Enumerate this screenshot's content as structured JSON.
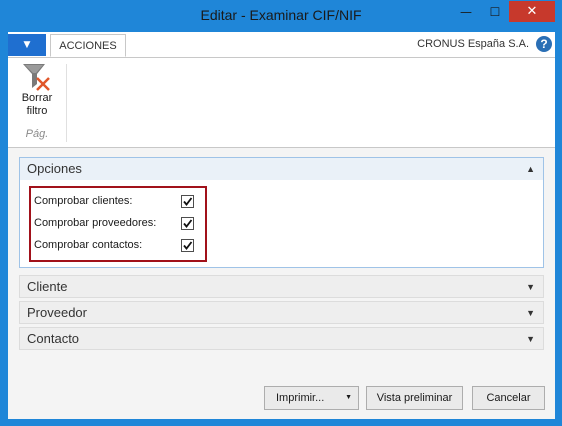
{
  "window": {
    "title": "Editar - Examinar CIF/NIF",
    "minimize_glyph": "—",
    "maximize_glyph": "☐",
    "close_glyph": "✕"
  },
  "ribbon": {
    "app_button_glyph": "▼",
    "tabs": [
      {
        "label": "ACCIONES",
        "active": true
      }
    ],
    "company": "CRONUS España S.A.",
    "help_glyph": "?",
    "buttons": [
      {
        "label_line1": "Borrar",
        "label_line2": "filtro",
        "icon": "clear-filter-icon"
      }
    ],
    "group_label": "Pág."
  },
  "fasttabs": {
    "opciones": {
      "title": "Opciones",
      "expanded": true,
      "options": [
        {
          "label": "Comprobar clientes:",
          "checked": true
        },
        {
          "label": "Comprobar proveedores:",
          "checked": true
        },
        {
          "label": "Comprobar contactos:",
          "checked": true
        }
      ]
    },
    "cliente": {
      "title": "Cliente",
      "expanded": false
    },
    "proveedor": {
      "title": "Proveedor",
      "expanded": false
    },
    "contacto": {
      "title": "Contacto",
      "expanded": false
    },
    "chevron_up": "▲",
    "chevron_down": "▼"
  },
  "footer": {
    "print_label": "Imprimir...",
    "print_dropdown_glyph": "▼",
    "preview_label": "Vista preliminar",
    "cancel_label": "Cancelar"
  },
  "colors": {
    "titlebar": "#1f86d8",
    "close_button": "#c7392c",
    "highlight_border": "#a1111a"
  }
}
